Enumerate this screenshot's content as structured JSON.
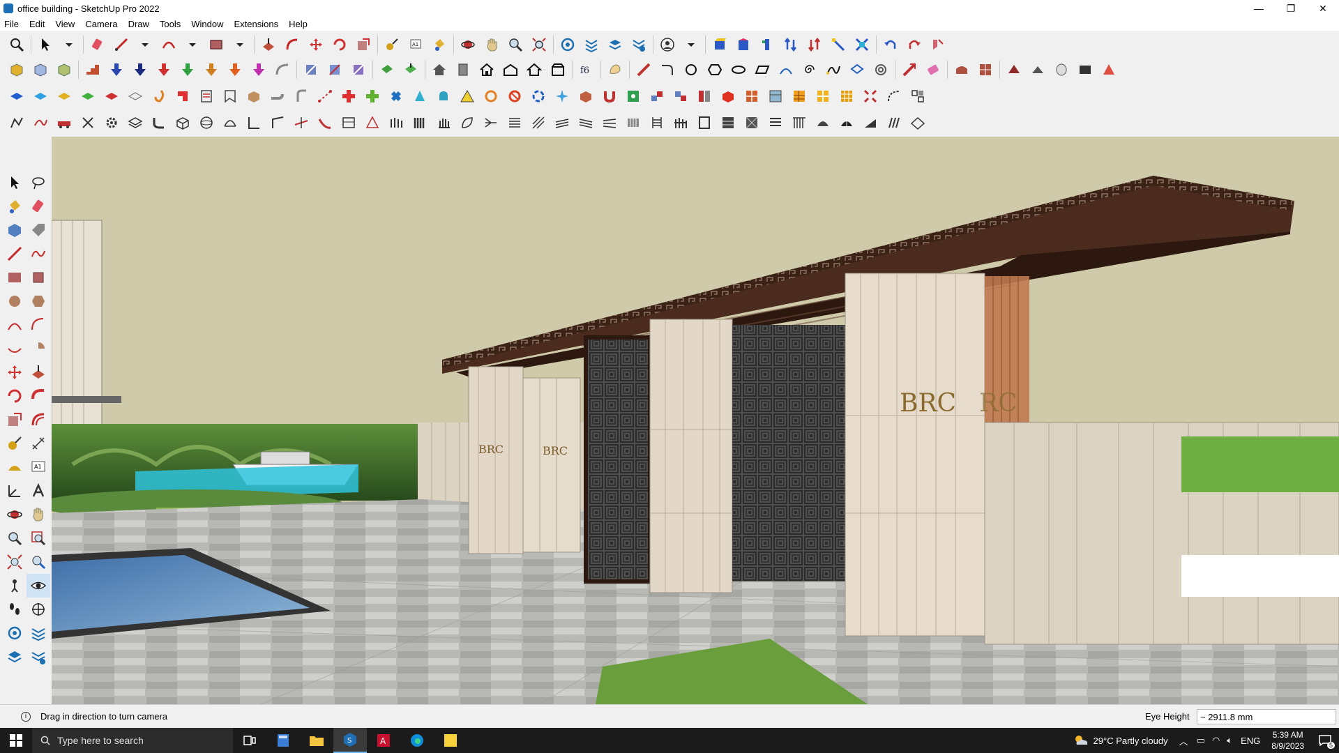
{
  "window": {
    "title": "office building - SketchUp Pro 2022",
    "minimize": "—",
    "maximize": "❐",
    "close": "✕"
  },
  "menu": [
    "File",
    "Edit",
    "View",
    "Camera",
    "Draw",
    "Tools",
    "Window",
    "Extensions",
    "Help"
  ],
  "viewport": {
    "sign_text": "BRC",
    "sky_color": "#cfcaa9",
    "roof_color": "#4a2b1e",
    "stone_color": "#e3d8c8",
    "screen_color": "#5c5c5c"
  },
  "status": {
    "message": "Drag in direction to turn camera",
    "measure_label": "Eye Height",
    "measure_value": "~ 2911.8 mm"
  },
  "taskbar": {
    "search_placeholder": "Type here to search",
    "weather": "29°C  Partly cloudy",
    "language": "ENG",
    "time": "5:39 AM",
    "date": "8/9/2023",
    "notifications": "5"
  }
}
